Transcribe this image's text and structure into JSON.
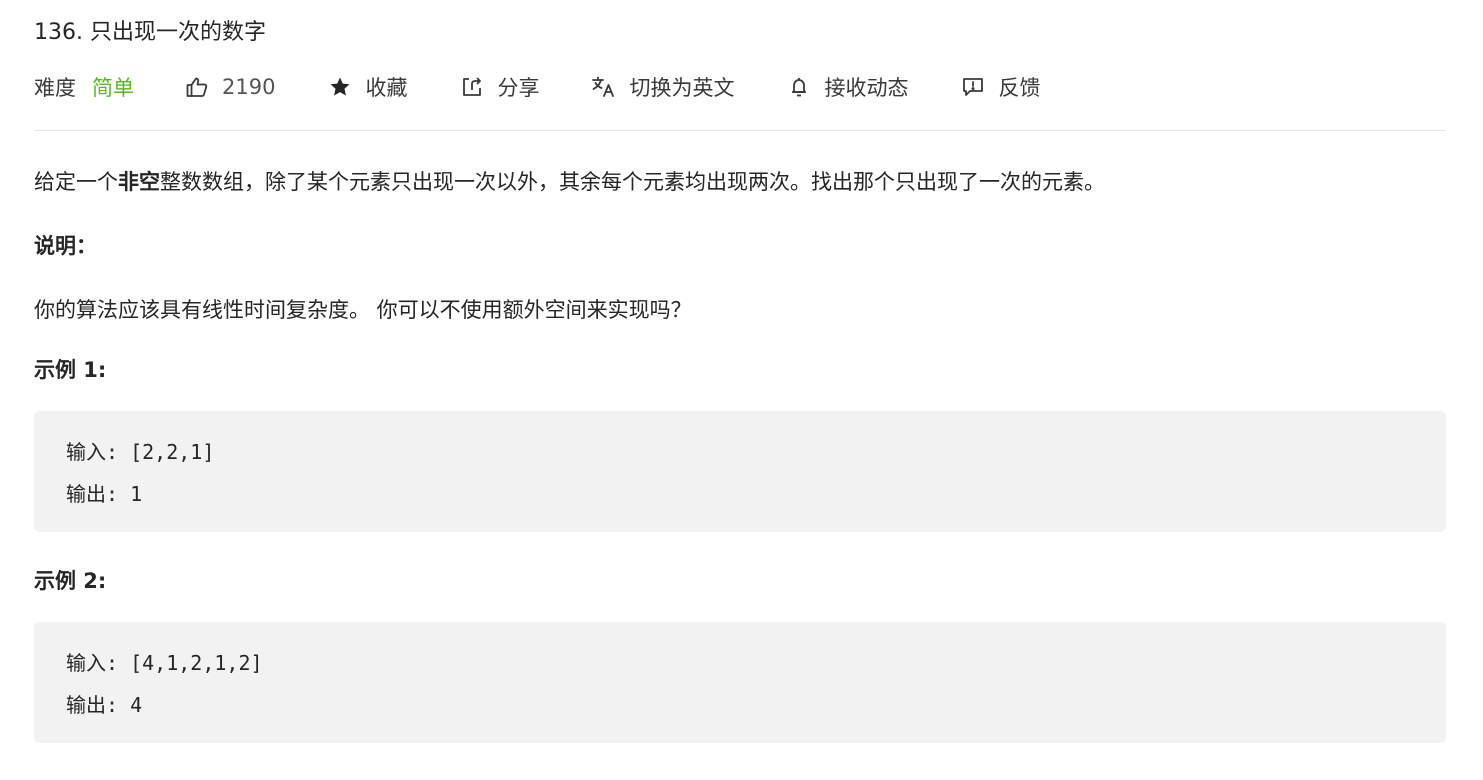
{
  "problem": {
    "title": "136. 只出现一次的数字"
  },
  "meta": {
    "difficulty_label": "难度",
    "difficulty_value": "简单",
    "like_count": "2190",
    "favorite_label": "收藏",
    "share_label": "分享",
    "switch_lang_label": "切换为英文",
    "notify_label": "接收动态",
    "feedback_label": "反馈",
    "colors": {
      "difficulty_easy": "#5ab726",
      "divider": "#e5e5e5",
      "code_bg": "#f2f2f3"
    },
    "icons": [
      "thumbs-up-icon",
      "star-icon",
      "share-icon",
      "translate-icon",
      "bell-icon",
      "feedback-icon"
    ]
  },
  "description": {
    "p1_before": "给定一个",
    "p1_bold": "非空",
    "p1_after": "整数数组，除了某个元素只出现一次以外，其余每个元素均出现两次。找出那个只出现了一次的元素。",
    "note_heading": "说明：",
    "note_text": "你的算法应该具有线性时间复杂度。 你可以不使用额外空间来实现吗？"
  },
  "examples": [
    {
      "heading": "示例 1:",
      "input": "输入: [2,2,1]",
      "output": "输出: 1"
    },
    {
      "heading": "示例 2:",
      "input": "输入: [4,1,2,1,2]",
      "output": "输出: 4"
    }
  ]
}
